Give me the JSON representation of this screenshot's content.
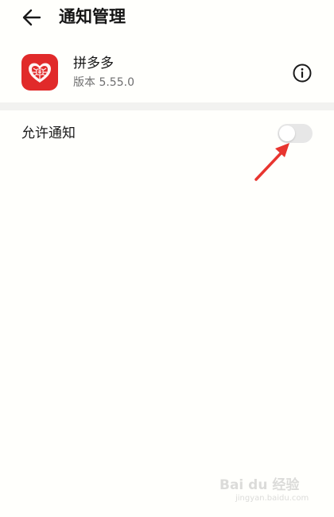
{
  "header": {
    "title": "通知管理",
    "back_icon": "arrow-left-icon"
  },
  "app": {
    "name": "拼多多",
    "version": "版本 5.55.0",
    "icon": "pinduoduo-app-icon",
    "icon_color": "#e12a2a",
    "info_icon": "info-circle-icon"
  },
  "settings": {
    "allow_notifications_label": "允许通知",
    "allow_notifications_value": false
  },
  "annotation": {
    "arrow_color": "#e8352f"
  },
  "watermark": {
    "brand": "Bai du 经验",
    "sub": "jingyan.baidu.com"
  },
  "colors": {
    "background": "#fffffc",
    "divider": "#f2f2f0",
    "toggle_off": "#e7e7e7"
  }
}
